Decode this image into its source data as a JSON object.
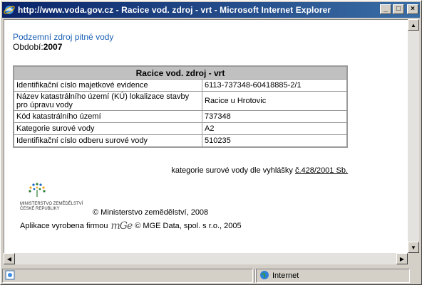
{
  "window": {
    "title": "http://www.voda.gov.cz - Racice vod. zdroj - vrt - Microsoft Internet Explorer",
    "minimize_label": "_",
    "maximize_label": "□",
    "close_label": "×"
  },
  "page": {
    "heading": "Podzemní zdroj pitné vody",
    "period_label": "Období:",
    "period_value": "2007",
    "table": {
      "caption": "Racice vod. zdroj - vrt",
      "rows": [
        {
          "key": "Identifikační císlo majetkové evidence",
          "value": "6113-737348-60418885-2/1"
        },
        {
          "key": "Název katastrálního území (KÚ) lokalizace stavby pro úpravu vody",
          "value": "Racice u Hrotovic"
        },
        {
          "key": "Kód katastrálního území",
          "value": "737348"
        },
        {
          "key": "Kategorie surové vody",
          "value": "A2"
        },
        {
          "key": "Identifikační císlo odberu surové vody",
          "value": "510235"
        }
      ]
    },
    "note_text": "kategorie surové vody dle vyhlášky ",
    "note_link": "č.428/2001 Sb.",
    "ministry_logo_text": "MINISTERSTVO ZEMĚDĚLSTVÍ ČESKÉ REPUBLIKY",
    "ministry_copyright": "© Ministerstvo zemědělství, 2008",
    "app_made_by": "Aplikace vyrobena firmou",
    "mge_logo_text": "mGe",
    "mge_copyright": "© MGE Data, spol. s r.o., 2005"
  },
  "statusbar": {
    "zone": "Internet"
  },
  "colors": {
    "title_bar": "#0a246a",
    "heading": "#1a5fb4",
    "table_header": "#c0c0c0"
  }
}
